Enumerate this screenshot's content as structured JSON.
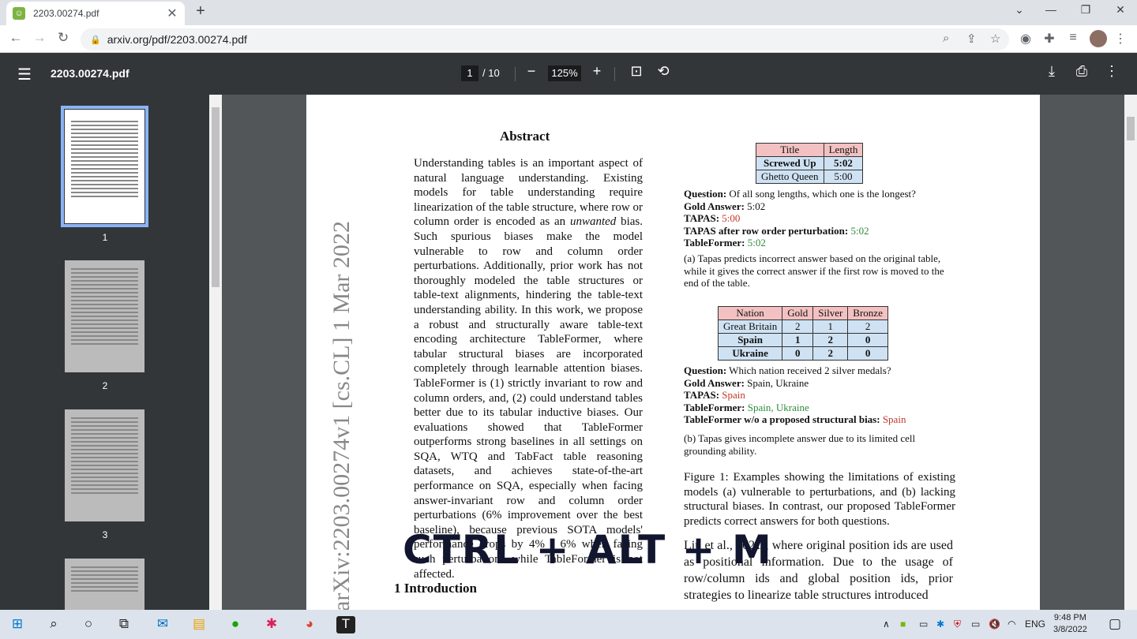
{
  "browser": {
    "tab_title": "2203.00274.pdf",
    "tab_close": "✕",
    "new_tab": "+",
    "url": "arxiv.org/pdf/2203.00274.pdf"
  },
  "pdf_toolbar": {
    "filename": "2203.00274.pdf",
    "current_page": "1",
    "total_pages": "/ 10",
    "zoom": "125%",
    "zoom_out": "−",
    "zoom_in": "+"
  },
  "thumbnails": [
    {
      "num": "1",
      "active": true
    },
    {
      "num": "2",
      "active": false
    },
    {
      "num": "3",
      "active": false
    }
  ],
  "paper": {
    "arxiv_id": "arXiv:2203.00274v1  [cs.CL]  1 Mar 2022",
    "abstract_heading": "Abstract",
    "abstract_before_em": "Understanding tables is an important aspect of natural language understanding. Existing models for table understanding require linearization of the table structure, where row or column order is encoded as an ",
    "abstract_em": "unwanted",
    "abstract_after_em": " bias. Such spurious biases make the model vulnerable to row and column order perturbations. Additionally, prior work has not thoroughly modeled the table structures or table-text alignments, hindering the table-text understanding ability. In this work, we propose a robust and structurally aware table-text encoding architecture TableFormer, where tabular structural biases are incorporated completely through learnable attention biases. TableFormer is (1) strictly invariant to row and column orders, and, (2) could understand tables better due to its tabular inductive biases. Our evaluations showed that TableFormer outperforms strong baselines in all settings on SQA, WTQ and TabFact table reasoning datasets, and achieves state-of-the-art performance on SQA, especially when facing answer-invariant row and column order perturbations (6% improvement over the best baseline), because previous SOTA models' performance drops by 4% - 6% when facing such perturbations while TableFormer is not affected.",
    "intro_heading": "1   Introduction",
    "table1": {
      "headers": [
        "Title",
        "Length"
      ],
      "rows": [
        [
          "Screwed Up",
          "5:02"
        ],
        [
          "Ghetto Queen",
          "5:00"
        ]
      ]
    },
    "qa1": {
      "question_label": "Question:",
      "question": " Of all song lengths, which one is the longest?",
      "gold_label": "Gold Answer:",
      "gold": " 5:02",
      "tapas_label": "TAPAS:",
      "tapas": " 5:00",
      "perturb_label": "TAPAS after row order perturbation:",
      "perturb": " 5:02",
      "tf_label": "TableFormer:",
      "tf": " 5:02"
    },
    "caption_a": "(a) Tapas predicts incorrect answer based on the original table, while it gives the correct answer if the first row is moved to the end of the table.",
    "table2": {
      "headers": [
        "Nation",
        "Gold",
        "Silver",
        "Bronze"
      ],
      "rows": [
        [
          "Great Britain",
          "2",
          "1",
          "2"
        ],
        [
          "Spain",
          "1",
          "2",
          "0"
        ],
        [
          "Ukraine",
          "0",
          "2",
          "0"
        ]
      ]
    },
    "qa2": {
      "question_label": "Question:",
      "question": " Which nation received 2 silver medals?",
      "gold_label": "Gold Answer:",
      "gold": " Spain, Ukraine",
      "tapas_label": "TAPAS:",
      "tapas": " Spain",
      "tf_label": "TableFormer:",
      "tf": " Spain, Ukraine",
      "wo_label": "TableFormer w/o a proposed structural bias:",
      "wo": " Spain"
    },
    "caption_b": "(b) Tapas gives incomplete answer due to its limited cell grounding ability.",
    "figure_caption": "Figure 1:   Examples showing the limitations of existing models (a) vulnerable to perturbations, and (b) lacking structural biases. In contrast, our proposed TableFormer predicts correct answers for both questions.",
    "body_text": "Liu et al., 2021), where original position ids are used as positional information. Due to the usage of row/column ids and global position ids, prior strategies to linearize table structures introduced"
  },
  "overlay_text": "CTRL + ALT + M",
  "taskbar": {
    "language": "ENG",
    "time": "9:48 PM",
    "date": "3/8/2022"
  },
  "colors": {
    "accent": "#8ab4f8",
    "pdf_toolbar": "#323639",
    "table_header": "#f3c1c1",
    "table_row": "#cfe2f3"
  }
}
